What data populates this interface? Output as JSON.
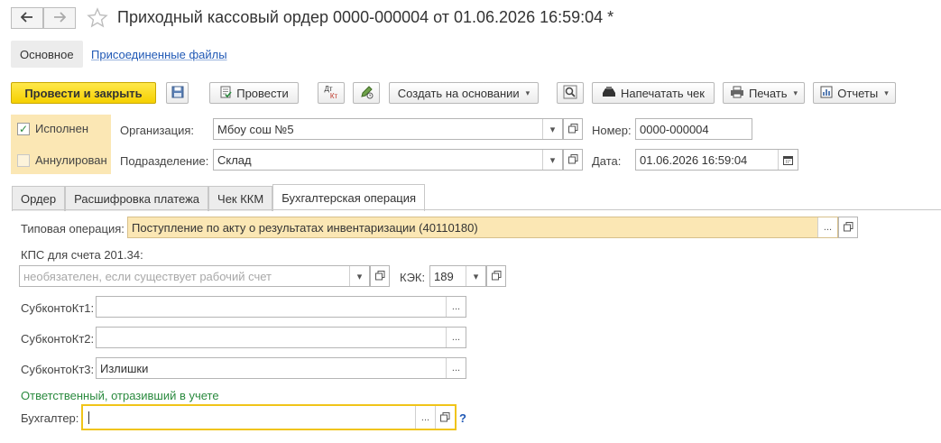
{
  "header": {
    "back_icon": "arrow-left-icon",
    "forward_icon": "arrow-right-icon",
    "favorite_icon": "star-icon",
    "title": "Приходный кассовый ордер 0000-000004 от 01.06.2026 16:59:04 *"
  },
  "sections": {
    "main": "Основное",
    "attached_files": "Присоединенные файлы"
  },
  "toolbar": {
    "post_and_close": "Провести и закрыть",
    "save_icon": "floppy-disk-icon",
    "post": "Провести",
    "dt_kt_icon": "dt-kt-icon",
    "dt_label": "Дт",
    "kt_label": "Кт",
    "edit_posting_icon": "pencil-icon",
    "create_based_on": "Создать на основании",
    "search_icon": "magnifier-icon",
    "print_receipt": "Напечатать чек",
    "print": "Печать",
    "reports": "Отчеты"
  },
  "status": {
    "executed_label": "Исполнен",
    "executed_checked": true,
    "cancelled_label": "Аннулирован",
    "cancelled_checked": false
  },
  "fields": {
    "organization_label": "Организация:",
    "organization_value": "Мбоу сош №5",
    "division_label": "Подразделение:",
    "division_value": "Склад",
    "number_label": "Номер:",
    "number_value": "0000-000004",
    "date_label": "Дата:",
    "date_value": "01.06.2026 16:59:04"
  },
  "tabs": [
    {
      "label": "Ордер",
      "active": false
    },
    {
      "label": "Расшифровка платежа",
      "active": false
    },
    {
      "label": "Чек ККМ",
      "active": false
    },
    {
      "label": "Бухгалтерская операция",
      "active": true
    }
  ],
  "operation": {
    "typical_operation_label": "Типовая операция:",
    "typical_operation_value": "Поступление по акту о результатах инвентаризации (40110180)",
    "kps_label": "КПС для счета 201.34:",
    "kps_placeholder": "необязателен, если существует рабочий счет",
    "kek_label": "КЭК:",
    "kek_value": "189",
    "subconto1_label": "СубконтоКт1:",
    "subconto1_value": "",
    "subconto2_label": "СубконтоКт2:",
    "subconto2_value": "",
    "subconto3_label": "СубконтоКт3:",
    "subconto3_value": "Излишки",
    "responsible_heading": "Ответственный, отразивший в учете",
    "accountant_label": "Бухгалтер:",
    "accountant_value": "",
    "help_label": "?"
  },
  "glyphs": {
    "ellipsis": "...",
    "dropdown": "▾"
  },
  "colors": {
    "accent_yellow": "#f5d000",
    "field_highlight": "#fbe7b4",
    "link_blue": "#1f58b5",
    "group_green": "#2a8a3e",
    "focus_border": "#f0c419"
  }
}
